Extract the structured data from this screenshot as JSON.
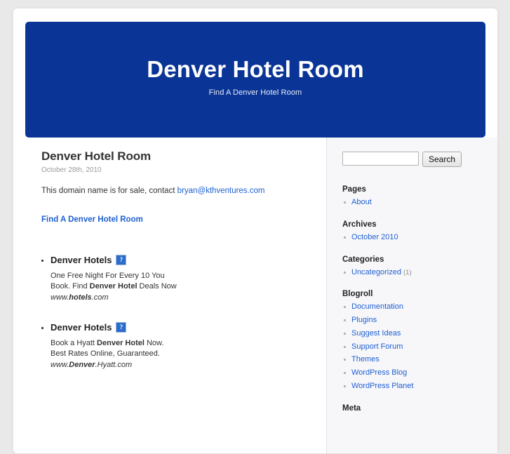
{
  "theme": {
    "header_bg": "#0a3596",
    "page_bg": "#e9e9e9",
    "link_color": "#1f5fd0",
    "sidebar_bg": "#f7f7fa"
  },
  "header": {
    "site_title": "Denver Hotel Room",
    "site_description": "Find A Denver Hotel Room"
  },
  "post": {
    "title": "Denver Hotel Room",
    "date": "October 28th, 2010",
    "paragraph_prefix": "This domain name is for sale, contact ",
    "contact_email": "bryan@kthventures.com",
    "standalone_link": "Find A Denver Hotel Room"
  },
  "ads": {
    "items": [
      {
        "heading": "Denver Hotels",
        "image_icon": "broken-image-icon",
        "image_icon_glyph": "?",
        "line1_a": "One Free Night For Every 10 You",
        "line2_a": "Book. Find ",
        "line2_b": "Denver Hotel",
        "line2_c": " Deals Now",
        "url_a": "www.",
        "url_b": "hotels",
        "url_c": ".com"
      },
      {
        "heading": "Denver Hotels",
        "image_icon": "broken-image-icon",
        "image_icon_glyph": "?",
        "line1_a": "Book a Hyatt ",
        "line1_b": "Denver Hotel",
        "line1_c": " Now.",
        "line2_a": "Best Rates Online, Guaranteed.",
        "url_a": "www.",
        "url_b": "Denver",
        "url_c": ".Hyatt.com"
      }
    ]
  },
  "sidebar": {
    "search": {
      "value": "",
      "placeholder": "",
      "button_label": "Search"
    },
    "widgets": [
      {
        "title": "Pages",
        "items": [
          {
            "label": "About",
            "count": ""
          }
        ]
      },
      {
        "title": "Archives",
        "items": [
          {
            "label": "October 2010",
            "count": ""
          }
        ]
      },
      {
        "title": "Categories",
        "items": [
          {
            "label": "Uncategorized",
            "count": "(1)"
          }
        ]
      },
      {
        "title": "Blogroll",
        "items": [
          {
            "label": "Documentation",
            "count": ""
          },
          {
            "label": "Plugins",
            "count": ""
          },
          {
            "label": "Suggest Ideas",
            "count": ""
          },
          {
            "label": "Support Forum",
            "count": ""
          },
          {
            "label": "Themes",
            "count": ""
          },
          {
            "label": "WordPress Blog",
            "count": ""
          },
          {
            "label": "WordPress Planet",
            "count": ""
          }
        ]
      },
      {
        "title": "Meta",
        "items": []
      }
    ]
  }
}
